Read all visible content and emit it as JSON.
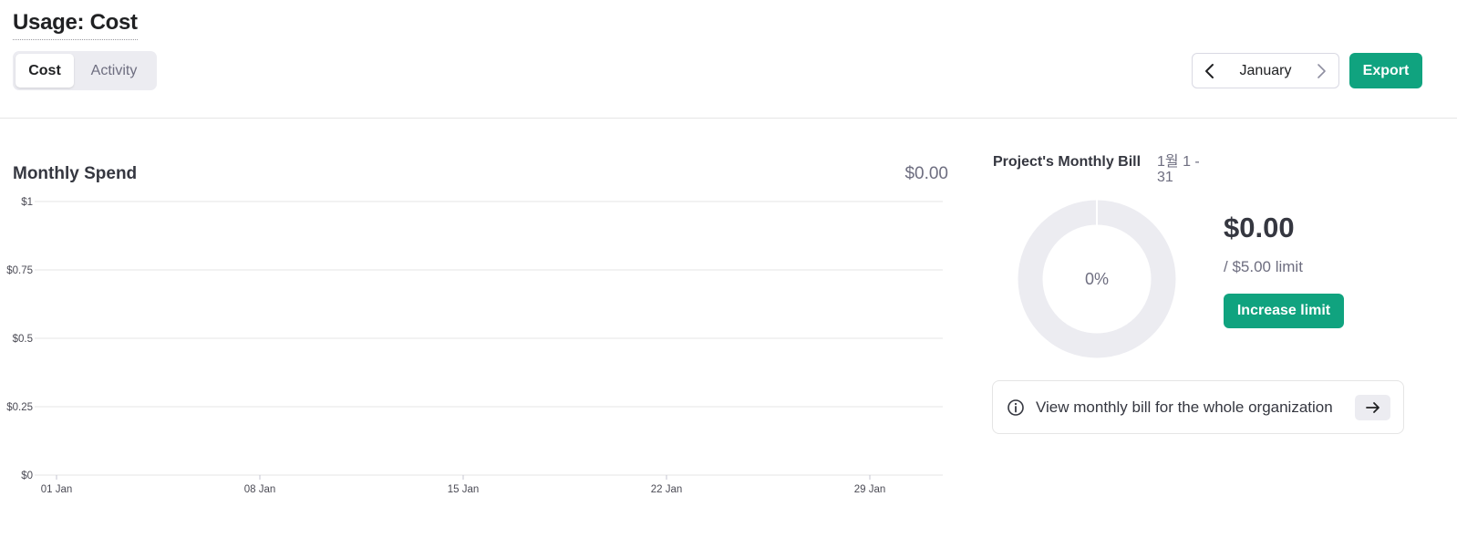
{
  "header": {
    "title": "Usage: Cost",
    "tabs": [
      {
        "label": "Cost",
        "active": true
      },
      {
        "label": "Activity",
        "active": false
      }
    ],
    "month": "January",
    "export_label": "Export"
  },
  "spend": {
    "title": "Monthly Spend",
    "total": "$0.00"
  },
  "chart_data": {
    "type": "bar",
    "y_tick_labels": [
      "$1",
      "$0.75",
      "$0.5",
      "$0.25",
      "$0"
    ],
    "x_tick_labels": [
      "01 Jan",
      "08 Jan",
      "15 Jan",
      "22 Jan",
      "29 Jan"
    ],
    "ylim": [
      0,
      1
    ],
    "grid": true,
    "values": []
  },
  "bill": {
    "title": "Project's Monthly Bill",
    "range": "1월 1 - 31",
    "percent_label": "0%",
    "percent_value": 0,
    "amount": "$0.00",
    "limit": "/ $5.00 limit",
    "increase_label": "Increase limit"
  },
  "org_link": {
    "text": "View monthly bill for the whole organization"
  },
  "colors": {
    "accent": "#10a37f",
    "donut_track": "#ececf1",
    "grid": "#e5e5e5"
  }
}
